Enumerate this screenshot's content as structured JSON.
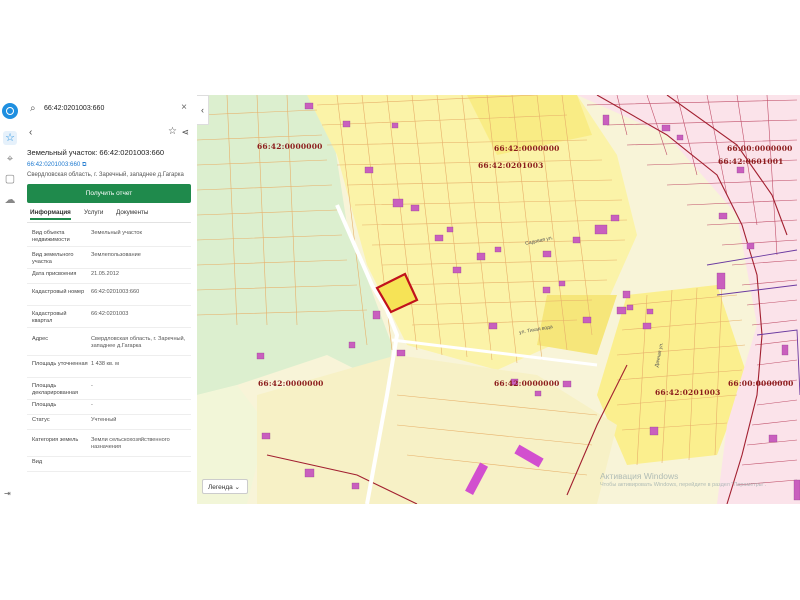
{
  "search": {
    "value": "66:42:0201003:660"
  },
  "panel": {
    "title": "Земельный участок: 66:42:0201003:660",
    "number_link": "66:42:0201003:660",
    "address_short": "Свердловская область, г. Заречный, западнее д.Гагарка",
    "report_button": "Получить отчет",
    "tabs": [
      "Информация",
      "Услуги",
      "Документы"
    ],
    "rows": [
      {
        "key": "Вид объекта недвижимости",
        "value": "Земельный участок"
      },
      {
        "key": "Вид земельного участка",
        "value": "Землепользование"
      },
      {
        "key": "Дата присвоения",
        "value": "21.05.2012"
      },
      {
        "key": "Кадастровый номер",
        "value": "66:42:0201003:660"
      },
      {
        "key": "Кадастровый квартал",
        "value": "66:42:0201003"
      },
      {
        "key": "Адрес",
        "value": "Свердловская область, г. Заречный, западнее д.Гагарка"
      },
      {
        "key": "Площадь уточненная",
        "value": "1 438 кв. м"
      },
      {
        "key": "Площадь декларированная",
        "value": "-"
      },
      {
        "key": "Площадь",
        "value": "-"
      },
      {
        "key": "Статус",
        "value": "Учтенный"
      },
      {
        "key": "Категория земель",
        "value": "Земли сельскохозяйственного назначения"
      },
      {
        "key": "Вид",
        "value": ""
      }
    ]
  },
  "map": {
    "labels": [
      {
        "text": "66:42:0000000",
        "pos": "l1"
      },
      {
        "text": "66:42:0000000",
        "pos": "l2"
      },
      {
        "text": "66:42:0201003",
        "pos": "l3"
      },
      {
        "text": "66:00:0000000",
        "pos": "l4"
      },
      {
        "text": "66:42:0601001",
        "pos": "l5"
      },
      {
        "text": "66:42:0000000",
        "pos": "l6"
      },
      {
        "text": "66:42:0000000",
        "pos": "l7"
      },
      {
        "text": "66:42:0201003",
        "pos": "l8"
      },
      {
        "text": "66:00:0000000",
        "pos": "l9"
      }
    ],
    "streets": [
      "Садовая ул.",
      "ул. Тихая вода",
      "Дачная ул."
    ],
    "legend_label": "Легенда",
    "watermark_title": "Активация Windows",
    "watermark_sub": "Чтобы активировать Windows, перейдите в раздел \"Параметры\".",
    "colors": {
      "parcel_fill": "#fbf3a0",
      "parcel_line": "#e8a15c",
      "forest": "#dcefcf",
      "building": "#c95fbe",
      "selected": "#c1121c"
    }
  }
}
